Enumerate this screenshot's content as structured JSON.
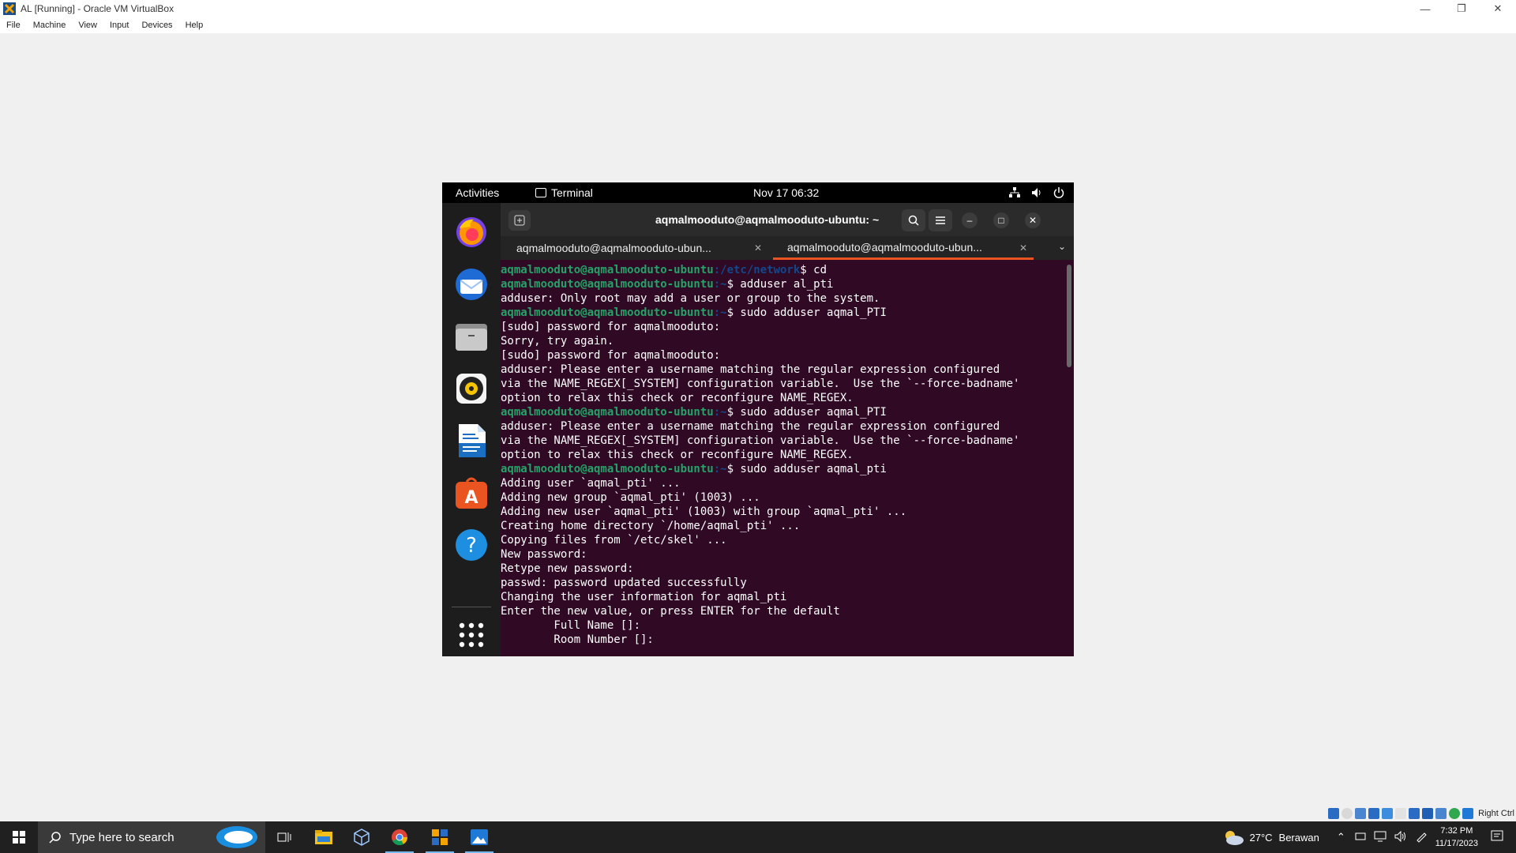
{
  "host": {
    "window_title": "AL [Running] - Oracle VM VirtualBox",
    "menu": [
      "File",
      "Machine",
      "View",
      "Input",
      "Devices",
      "Help"
    ],
    "host_key": "Right Ctrl"
  },
  "gnome": {
    "activities": "Activities",
    "app_name": "Terminal",
    "clock": "Nov 17  06:32"
  },
  "terminal": {
    "title": "aqmalmooduto@aqmalmooduto-ubuntu: ~",
    "tabs": [
      {
        "label": "aqmalmooduto@aqmalmooduto-ubun...",
        "active": false
      },
      {
        "label": "aqmalmooduto@aqmalmooduto-ubun...",
        "active": true
      }
    ],
    "lines": [
      {
        "user": "aqmalmooduto@aqmalmooduto-ubuntu",
        "path": ":/etc/network",
        "cmd": "$ cd"
      },
      {
        "user": "aqmalmooduto@aqmalmooduto-ubuntu",
        "path": ":~",
        "cmd": "$ adduser al_pti"
      },
      {
        "text": "adduser: Only root may add a user or group to the system."
      },
      {
        "user": "aqmalmooduto@aqmalmooduto-ubuntu",
        "path": ":~",
        "cmd": "$ sudo adduser aqmal_PTI"
      },
      {
        "text": "[sudo] password for aqmalmooduto:"
      },
      {
        "text": "Sorry, try again."
      },
      {
        "text": "[sudo] password for aqmalmooduto:"
      },
      {
        "text": "adduser: Please enter a username matching the regular expression configured"
      },
      {
        "text": "via the NAME_REGEX[_SYSTEM] configuration variable.  Use the `--force-badname'"
      },
      {
        "text": "option to relax this check or reconfigure NAME_REGEX."
      },
      {
        "user": "aqmalmooduto@aqmalmooduto-ubuntu",
        "path": ":~",
        "cmd": "$ sudo adduser aqmal_PTI"
      },
      {
        "text": "adduser: Please enter a username matching the regular expression configured"
      },
      {
        "text": "via the NAME_REGEX[_SYSTEM] configuration variable.  Use the `--force-badname'"
      },
      {
        "text": "option to relax this check or reconfigure NAME_REGEX."
      },
      {
        "user": "aqmalmooduto@aqmalmooduto-ubuntu",
        "path": ":~",
        "cmd": "$ sudo adduser aqmal_pti"
      },
      {
        "text": "Adding user `aqmal_pti' ..."
      },
      {
        "text": "Adding new group `aqmal_pti' (1003) ..."
      },
      {
        "text": "Adding new user `aqmal_pti' (1003) with group `aqmal_pti' ..."
      },
      {
        "text": "Creating home directory `/home/aqmal_pti' ..."
      },
      {
        "text": "Copying files from `/etc/skel' ..."
      },
      {
        "text": "New password:"
      },
      {
        "text": "Retype new password:"
      },
      {
        "text": "passwd: password updated successfully"
      },
      {
        "text": "Changing the user information for aqmal_pti"
      },
      {
        "text": "Enter the new value, or press ENTER for the default"
      },
      {
        "text": "        Full Name []:"
      },
      {
        "text": "        Room Number []:"
      }
    ]
  },
  "dock": {
    "items": [
      "firefox-icon",
      "thunderbird-icon",
      "files-icon",
      "rhythmbox-icon",
      "libreoffice-writer-icon",
      "software-center-icon",
      "help-icon"
    ]
  },
  "taskbar": {
    "search_placeholder": "Type here to search",
    "weather_temp": "27°C",
    "weather_text": "Berawan",
    "time": "7:32 PM",
    "date": "11/17/2023"
  },
  "colors": {
    "terminal_bg": "#300a24",
    "prompt_user": "#26a269",
    "prompt_path": "#12488b",
    "accent": "#e95420"
  }
}
